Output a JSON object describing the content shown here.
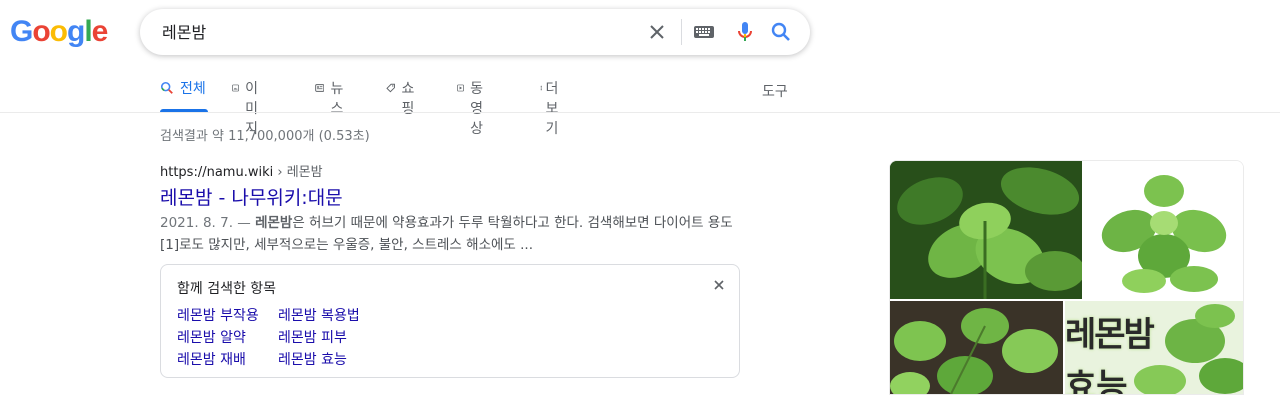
{
  "logo": {
    "letters": [
      "G",
      "o",
      "o",
      "g",
      "l",
      "e"
    ]
  },
  "search": {
    "query": "레몬밤"
  },
  "tabs": [
    {
      "label": "전체",
      "icon": "search-icon",
      "active": true
    },
    {
      "label": "이미지",
      "icon": "image-icon"
    },
    {
      "label": "뉴스",
      "icon": "news-icon"
    },
    {
      "label": "쇼핑",
      "icon": "tag-icon"
    },
    {
      "label": "동영상",
      "icon": "video-icon"
    },
    {
      "label": "더보기",
      "icon": "more-vert-icon"
    }
  ],
  "tools_label": "도구",
  "stats": "검색결과 약 11,700,000개 (0.53초)",
  "result": {
    "url": "https://namu.wiki",
    "breadcrumb": " › 레몬밤",
    "title": "레몬밤 - 나무위키:대문",
    "date": "2021. 8. 7. — ",
    "snippet_bold": "레몬밤",
    "snippet_rest": "은 허브기 때문에 약용효과가 두루 탁월하다고 한다. 검색해보면 다이어트 용도[1]로도 많지만, 세부적으로는 우울증, 불안, 스트레스 해소에도 ..."
  },
  "related": {
    "title": "함께 검색한 항목",
    "links": [
      "레몬밤 부작용",
      "레몬밤 복용법",
      "레몬밤 알약",
      "레몬밤 피부",
      "레몬밤 재배",
      "레몬밤 효능"
    ]
  },
  "image_overlay_text": "레몬밤",
  "image_overlay_text2": "효능",
  "colors": {
    "link": "#1a0dab",
    "accent": "#1a73e8",
    "leaf": "#5aa83c"
  }
}
